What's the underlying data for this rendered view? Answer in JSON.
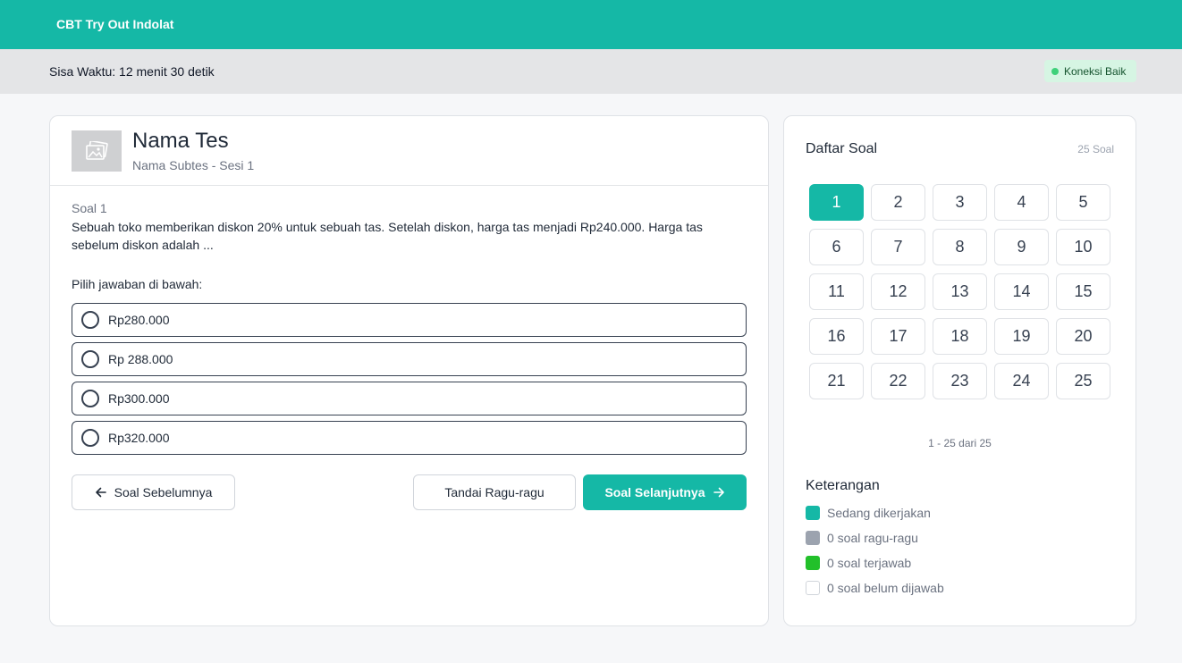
{
  "app": {
    "title": "CBT Try Out Indolat"
  },
  "status": {
    "timer_text": "Sisa Waktu: 12 menit 30 detik",
    "connection_label": "Koneksi Baik"
  },
  "test": {
    "name": "Nama Tes",
    "subtitle": "Nama Subtes - Sesi 1"
  },
  "question": {
    "number_label": "Soal 1",
    "text": "Sebuah toko memberikan diskon 20% untuk sebuah tas. Setelah diskon, harga tas menjadi Rp240.000. Harga tas sebelum diskon adalah ...",
    "choose_label": "Pilih jawaban di bawah:",
    "options": [
      {
        "label": "Rp280.000"
      },
      {
        "label": "Rp 288.000"
      },
      {
        "label": "Rp300.000"
      },
      {
        "label": "Rp320.000"
      }
    ]
  },
  "nav": {
    "prev_label": "Soal Sebelumnya",
    "flag_label": "Tandai Ragu-ragu",
    "next_label": "Soal Selanjutnya"
  },
  "question_list": {
    "title": "Daftar Soal",
    "count_label": "25 Soal",
    "numbers": [
      "1",
      "2",
      "3",
      "4",
      "5",
      "6",
      "7",
      "8",
      "9",
      "10",
      "11",
      "12",
      "13",
      "14",
      "15",
      "16",
      "17",
      "18",
      "19",
      "20",
      "21",
      "22",
      "23",
      "24",
      "25"
    ],
    "active": "1",
    "paging_label": "1 - 25 dari 25"
  },
  "legend": {
    "title": "Keterangan",
    "items": [
      {
        "label": "Sedang dikerjakan",
        "color": "#15b8a6"
      },
      {
        "label": "0 soal ragu-ragu",
        "color": "#9ca3af"
      },
      {
        "label": "0 soal terjawab",
        "color": "#22c02a"
      },
      {
        "label": "0 soal belum dijawab",
        "color": "#ffffff"
      }
    ]
  },
  "colors": {
    "accent": "#15b8a6",
    "connection_dot": "#3fd17a"
  }
}
